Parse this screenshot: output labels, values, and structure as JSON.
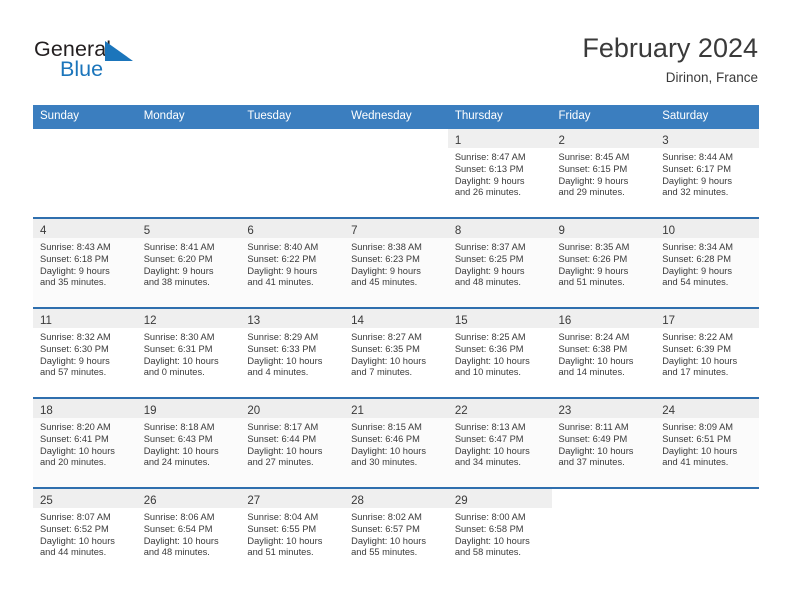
{
  "brand": {
    "name_part1": "General",
    "name_part2": "Blue",
    "mark_icon": "blue-triangle-logo-icon",
    "accent_color": "#1b75bb"
  },
  "header": {
    "title": "February 2024",
    "location": "Dirinon, France"
  },
  "theme": {
    "header_bar_color": "#3b7ebf",
    "row_divider_color": "#2f6fae",
    "daynum_band_color": "#efefef"
  },
  "calendar": {
    "weekday_headers": [
      "Sunday",
      "Monday",
      "Tuesday",
      "Wednesday",
      "Thursday",
      "Friday",
      "Saturday"
    ],
    "weeks": [
      [
        {
          "day": "",
          "lines": []
        },
        {
          "day": "",
          "lines": []
        },
        {
          "day": "",
          "lines": []
        },
        {
          "day": "",
          "lines": []
        },
        {
          "day": "1",
          "lines": [
            "Sunrise: 8:47 AM",
            "Sunset: 6:13 PM",
            "Daylight: 9 hours",
            "and 26 minutes."
          ]
        },
        {
          "day": "2",
          "lines": [
            "Sunrise: 8:45 AM",
            "Sunset: 6:15 PM",
            "Daylight: 9 hours",
            "and 29 minutes."
          ]
        },
        {
          "day": "3",
          "lines": [
            "Sunrise: 8:44 AM",
            "Sunset: 6:17 PM",
            "Daylight: 9 hours",
            "and 32 minutes."
          ]
        }
      ],
      [
        {
          "day": "4",
          "lines": [
            "Sunrise: 8:43 AM",
            "Sunset: 6:18 PM",
            "Daylight: 9 hours",
            "and 35 minutes."
          ]
        },
        {
          "day": "5",
          "lines": [
            "Sunrise: 8:41 AM",
            "Sunset: 6:20 PM",
            "Daylight: 9 hours",
            "and 38 minutes."
          ]
        },
        {
          "day": "6",
          "lines": [
            "Sunrise: 8:40 AM",
            "Sunset: 6:22 PM",
            "Daylight: 9 hours",
            "and 41 minutes."
          ]
        },
        {
          "day": "7",
          "lines": [
            "Sunrise: 8:38 AM",
            "Sunset: 6:23 PM",
            "Daylight: 9 hours",
            "and 45 minutes."
          ]
        },
        {
          "day": "8",
          "lines": [
            "Sunrise: 8:37 AM",
            "Sunset: 6:25 PM",
            "Daylight: 9 hours",
            "and 48 minutes."
          ]
        },
        {
          "day": "9",
          "lines": [
            "Sunrise: 8:35 AM",
            "Sunset: 6:26 PM",
            "Daylight: 9 hours",
            "and 51 minutes."
          ]
        },
        {
          "day": "10",
          "lines": [
            "Sunrise: 8:34 AM",
            "Sunset: 6:28 PM",
            "Daylight: 9 hours",
            "and 54 minutes."
          ]
        }
      ],
      [
        {
          "day": "11",
          "lines": [
            "Sunrise: 8:32 AM",
            "Sunset: 6:30 PM",
            "Daylight: 9 hours",
            "and 57 minutes."
          ]
        },
        {
          "day": "12",
          "lines": [
            "Sunrise: 8:30 AM",
            "Sunset: 6:31 PM",
            "Daylight: 10 hours",
            "and 0 minutes."
          ]
        },
        {
          "day": "13",
          "lines": [
            "Sunrise: 8:29 AM",
            "Sunset: 6:33 PM",
            "Daylight: 10 hours",
            "and 4 minutes."
          ]
        },
        {
          "day": "14",
          "lines": [
            "Sunrise: 8:27 AM",
            "Sunset: 6:35 PM",
            "Daylight: 10 hours",
            "and 7 minutes."
          ]
        },
        {
          "day": "15",
          "lines": [
            "Sunrise: 8:25 AM",
            "Sunset: 6:36 PM",
            "Daylight: 10 hours",
            "and 10 minutes."
          ]
        },
        {
          "day": "16",
          "lines": [
            "Sunrise: 8:24 AM",
            "Sunset: 6:38 PM",
            "Daylight: 10 hours",
            "and 14 minutes."
          ]
        },
        {
          "day": "17",
          "lines": [
            "Sunrise: 8:22 AM",
            "Sunset: 6:39 PM",
            "Daylight: 10 hours",
            "and 17 minutes."
          ]
        }
      ],
      [
        {
          "day": "18",
          "lines": [
            "Sunrise: 8:20 AM",
            "Sunset: 6:41 PM",
            "Daylight: 10 hours",
            "and 20 minutes."
          ]
        },
        {
          "day": "19",
          "lines": [
            "Sunrise: 8:18 AM",
            "Sunset: 6:43 PM",
            "Daylight: 10 hours",
            "and 24 minutes."
          ]
        },
        {
          "day": "20",
          "lines": [
            "Sunrise: 8:17 AM",
            "Sunset: 6:44 PM",
            "Daylight: 10 hours",
            "and 27 minutes."
          ]
        },
        {
          "day": "21",
          "lines": [
            "Sunrise: 8:15 AM",
            "Sunset: 6:46 PM",
            "Daylight: 10 hours",
            "and 30 minutes."
          ]
        },
        {
          "day": "22",
          "lines": [
            "Sunrise: 8:13 AM",
            "Sunset: 6:47 PM",
            "Daylight: 10 hours",
            "and 34 minutes."
          ]
        },
        {
          "day": "23",
          "lines": [
            "Sunrise: 8:11 AM",
            "Sunset: 6:49 PM",
            "Daylight: 10 hours",
            "and 37 minutes."
          ]
        },
        {
          "day": "24",
          "lines": [
            "Sunrise: 8:09 AM",
            "Sunset: 6:51 PM",
            "Daylight: 10 hours",
            "and 41 minutes."
          ]
        }
      ],
      [
        {
          "day": "25",
          "lines": [
            "Sunrise: 8:07 AM",
            "Sunset: 6:52 PM",
            "Daylight: 10 hours",
            "and 44 minutes."
          ]
        },
        {
          "day": "26",
          "lines": [
            "Sunrise: 8:06 AM",
            "Sunset: 6:54 PM",
            "Daylight: 10 hours",
            "and 48 minutes."
          ]
        },
        {
          "day": "27",
          "lines": [
            "Sunrise: 8:04 AM",
            "Sunset: 6:55 PM",
            "Daylight: 10 hours",
            "and 51 minutes."
          ]
        },
        {
          "day": "28",
          "lines": [
            "Sunrise: 8:02 AM",
            "Sunset: 6:57 PM",
            "Daylight: 10 hours",
            "and 55 minutes."
          ]
        },
        {
          "day": "29",
          "lines": [
            "Sunrise: 8:00 AM",
            "Sunset: 6:58 PM",
            "Daylight: 10 hours",
            "and 58 minutes."
          ]
        },
        {
          "day": "",
          "lines": []
        },
        {
          "day": "",
          "lines": []
        }
      ]
    ]
  }
}
